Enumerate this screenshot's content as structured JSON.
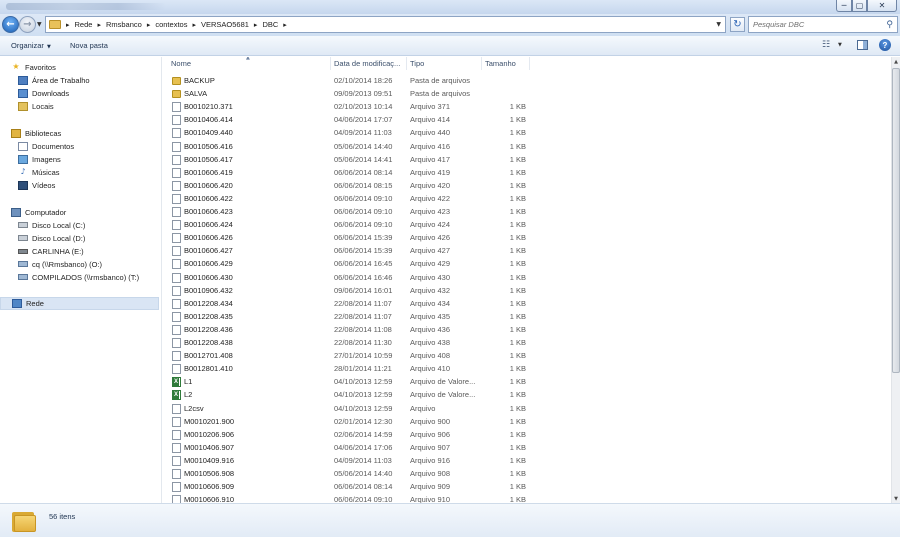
{
  "window": {
    "minimize_glyph": "─",
    "maximize_glyph": "▢",
    "close_glyph": "✕"
  },
  "address": {
    "back_glyph": "←",
    "forward_glyph": "→",
    "crumbs": [
      "Rede",
      "Rmsbanco",
      "contextos",
      "VERSAO5681",
      "DBC"
    ],
    "refresh_glyph": "↻",
    "search_placeholder": "Pesquisar DBC"
  },
  "toolbar": {
    "organize_label": "Organizar",
    "new_folder_label": "Nova pasta"
  },
  "nav": {
    "favorites_header": "Favoritos",
    "desktop": "Área de Trabalho",
    "downloads": "Downloads",
    "locais": "Locais",
    "libraries_header": "Bibliotecas",
    "documentos": "Documentos",
    "imagens": "Imagens",
    "musicas": "Músicas",
    "videos": "Vídeos",
    "computer_header": "Computador",
    "disk_c": "Disco Local (C:)",
    "disk_d": "Disco Local (D:)",
    "usb_e": "CARLINHA (E:)",
    "net_o": "cq (\\\\Rmsbanco) (O:)",
    "net_t": "COMPILADOS (\\\\rmsbanco) (T:)",
    "network_header": "Rede"
  },
  "columns": {
    "name": "Nome",
    "date": "Data de modificaç...",
    "type": "Tipo",
    "size": "Tamanho"
  },
  "files": [
    {
      "name": "BACKUP",
      "date": "02/10/2014 18:26",
      "type": "Pasta de arquivos",
      "size": "",
      "kind": "folder"
    },
    {
      "name": "SALVA",
      "date": "09/09/2013 09:51",
      "type": "Pasta de arquivos",
      "size": "",
      "kind": "folder"
    },
    {
      "name": "B0010210.371",
      "date": "02/10/2013 10:14",
      "type": "Arquivo 371",
      "size": "1 KB",
      "kind": "file"
    },
    {
      "name": "B0010406.414",
      "date": "04/06/2014 17:07",
      "type": "Arquivo 414",
      "size": "1 KB",
      "kind": "file"
    },
    {
      "name": "B0010409.440",
      "date": "04/09/2014 11:03",
      "type": "Arquivo 440",
      "size": "1 KB",
      "kind": "file"
    },
    {
      "name": "B0010506.416",
      "date": "05/06/2014 14:40",
      "type": "Arquivo 416",
      "size": "1 KB",
      "kind": "file"
    },
    {
      "name": "B0010506.417",
      "date": "05/06/2014 14:41",
      "type": "Arquivo 417",
      "size": "1 KB",
      "kind": "file"
    },
    {
      "name": "B0010606.419",
      "date": "06/06/2014 08:14",
      "type": "Arquivo 419",
      "size": "1 KB",
      "kind": "file"
    },
    {
      "name": "B0010606.420",
      "date": "06/06/2014 08:15",
      "type": "Arquivo 420",
      "size": "1 KB",
      "kind": "file"
    },
    {
      "name": "B0010606.422",
      "date": "06/06/2014 09:10",
      "type": "Arquivo 422",
      "size": "1 KB",
      "kind": "file"
    },
    {
      "name": "B0010606.423",
      "date": "06/06/2014 09:10",
      "type": "Arquivo 423",
      "size": "1 KB",
      "kind": "file"
    },
    {
      "name": "B0010606.424",
      "date": "06/06/2014 09:10",
      "type": "Arquivo 424",
      "size": "1 KB",
      "kind": "file"
    },
    {
      "name": "B0010606.426",
      "date": "06/06/2014 15:39",
      "type": "Arquivo 426",
      "size": "1 KB",
      "kind": "file"
    },
    {
      "name": "B0010606.427",
      "date": "06/06/2014 15:39",
      "type": "Arquivo 427",
      "size": "1 KB",
      "kind": "file"
    },
    {
      "name": "B0010606.429",
      "date": "06/06/2014 16:45",
      "type": "Arquivo 429",
      "size": "1 KB",
      "kind": "file"
    },
    {
      "name": "B0010606.430",
      "date": "06/06/2014 16:46",
      "type": "Arquivo 430",
      "size": "1 KB",
      "kind": "file"
    },
    {
      "name": "B0010906.432",
      "date": "09/06/2014 16:01",
      "type": "Arquivo 432",
      "size": "1 KB",
      "kind": "file"
    },
    {
      "name": "B0012208.434",
      "date": "22/08/2014 11:07",
      "type": "Arquivo 434",
      "size": "1 KB",
      "kind": "file"
    },
    {
      "name": "B0012208.435",
      "date": "22/08/2014 11:07",
      "type": "Arquivo 435",
      "size": "1 KB",
      "kind": "file"
    },
    {
      "name": "B0012208.436",
      "date": "22/08/2014 11:08",
      "type": "Arquivo 436",
      "size": "1 KB",
      "kind": "file"
    },
    {
      "name": "B0012208.438",
      "date": "22/08/2014 11:30",
      "type": "Arquivo 438",
      "size": "1 KB",
      "kind": "file"
    },
    {
      "name": "B0012701.408",
      "date": "27/01/2014 10:59",
      "type": "Arquivo 408",
      "size": "1 KB",
      "kind": "file"
    },
    {
      "name": "B0012801.410",
      "date": "28/01/2014 11:21",
      "type": "Arquivo 410",
      "size": "1 KB",
      "kind": "file"
    },
    {
      "name": "L1",
      "date": "04/10/2013 12:59",
      "type": "Arquivo de Valore...",
      "size": "1 KB",
      "kind": "xls"
    },
    {
      "name": "L2",
      "date": "04/10/2013 12:59",
      "type": "Arquivo de Valore...",
      "size": "1 KB",
      "kind": "xls"
    },
    {
      "name": "L2csv",
      "date": "04/10/2013 12:59",
      "type": "Arquivo",
      "size": "1 KB",
      "kind": "file"
    },
    {
      "name": "M0010201.900",
      "date": "02/01/2014 12:30",
      "type": "Arquivo 900",
      "size": "1 KB",
      "kind": "file"
    },
    {
      "name": "M0010206.906",
      "date": "02/06/2014 14:59",
      "type": "Arquivo 906",
      "size": "1 KB",
      "kind": "file"
    },
    {
      "name": "M0010406.907",
      "date": "04/06/2014 17:06",
      "type": "Arquivo 907",
      "size": "1 KB",
      "kind": "file"
    },
    {
      "name": "M0010409.916",
      "date": "04/09/2014 11:03",
      "type": "Arquivo 916",
      "size": "1 KB",
      "kind": "file"
    },
    {
      "name": "M0010506.908",
      "date": "05/06/2014 14:40",
      "type": "Arquivo 908",
      "size": "1 KB",
      "kind": "file"
    },
    {
      "name": "M0010606.909",
      "date": "06/06/2014 08:14",
      "type": "Arquivo 909",
      "size": "1 KB",
      "kind": "file"
    },
    {
      "name": "M0010606.910",
      "date": "06/06/2014 09:10",
      "type": "Arquivo 910",
      "size": "1 KB",
      "kind": "file"
    }
  ],
  "details": {
    "item_count": "56 itens"
  }
}
